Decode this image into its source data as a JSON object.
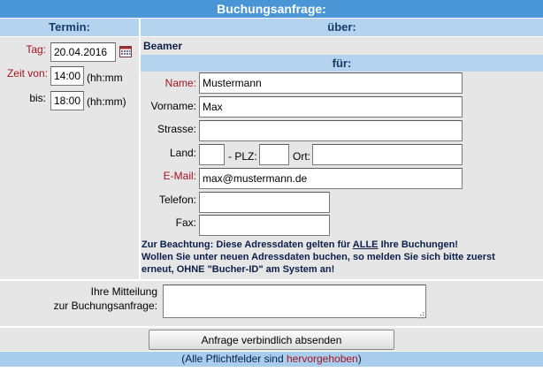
{
  "title": "Buchungsanfrage:",
  "headers": {
    "termin": "Termin:",
    "ueber": "über:",
    "fuer": "für:"
  },
  "resource": "Beamer",
  "termin": {
    "tag_label": "Tag:",
    "tag_value": "20.04.2016",
    "zeitvon_label": "Zeit von:",
    "zeitvon_value": "14:00",
    "zeitvon_hint": "(hh:mm",
    "bis_label": "bis:",
    "bis_value": "18:00",
    "bis_hint": "(hh:mm)"
  },
  "address": {
    "name_label": "Name:",
    "name_value": "Mustermann",
    "vorname_label": "Vorname:",
    "vorname_value": "Max",
    "strasse_label": "Strasse:",
    "strasse_value": "",
    "land_label": "Land:",
    "land_value": "",
    "plz_label": "- PLZ:",
    "plz_value": "",
    "ort_label": "Ort:",
    "ort_value": "",
    "email_label": "E-Mail:",
    "email_value": "max@mustermann.de",
    "telefon_label": "Telefon:",
    "telefon_value": "",
    "fax_label": "Fax:",
    "fax_value": ""
  },
  "note": {
    "line1_pre": "Zur Beachtung: Diese Adressdaten gelten für ",
    "line1_alle": "ALLE",
    "line1_post": " Ihre Buchungen!",
    "line2": "Wollen Sie unter neuen Adressdaten buchen, so melden Sie sich bitte zuerst",
    "line3": "erneut, OHNE \"Bucher-ID\" am System an!"
  },
  "message": {
    "label_line1": "Ihre Mitteilung",
    "label_line2": "zur Buchungsanfrage:",
    "value": ""
  },
  "submit_label": "Anfrage verbindlich absenden",
  "footer": {
    "pre": "(Alle Pflichtfelder sind ",
    "highlight": "hervorgehoben",
    "post": ")"
  },
  "colors": {
    "title_bar": "#4a95d6",
    "header": "#b3d3ee",
    "panel": "#e6e6e6",
    "required": "#a3141f",
    "footer": "#a9cdec"
  }
}
